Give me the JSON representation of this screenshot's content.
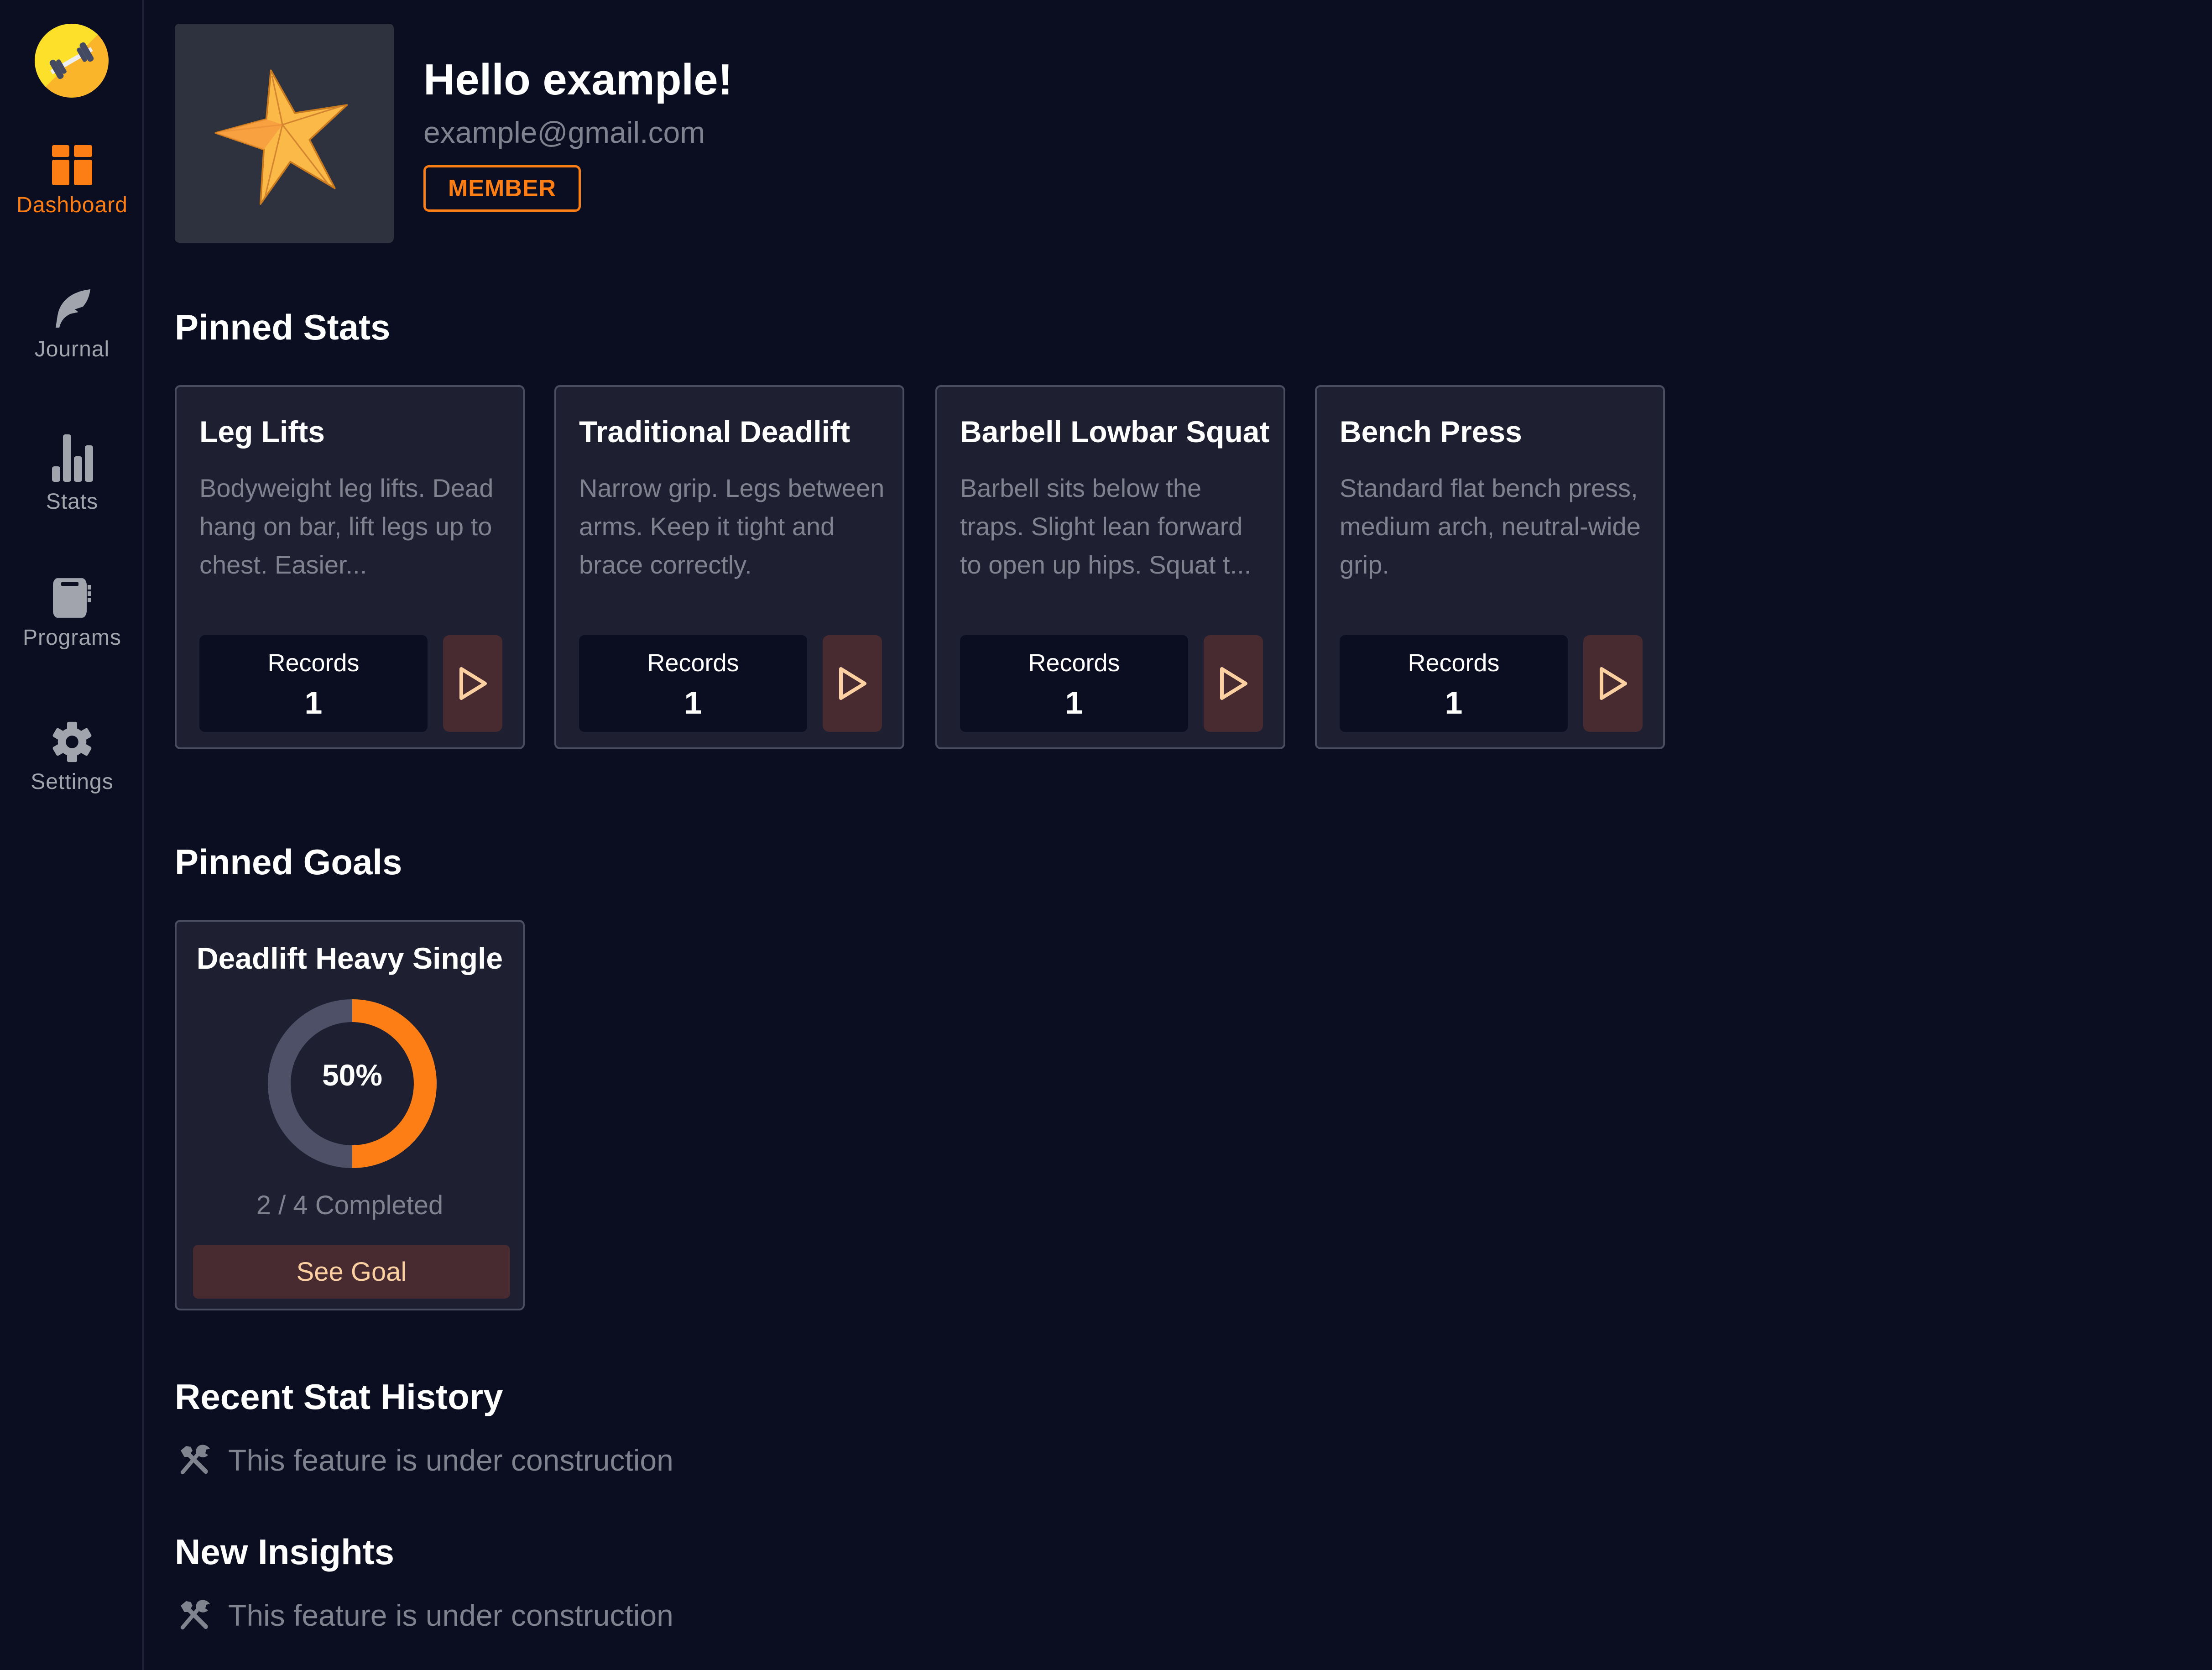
{
  "sidebar": {
    "logo": "dumbbell-logo",
    "items": [
      {
        "label": "Dashboard",
        "icon": "dashboard-icon",
        "active": true
      },
      {
        "label": "Journal",
        "icon": "feather-icon",
        "active": false
      },
      {
        "label": "Stats",
        "icon": "bar-chart-icon",
        "active": false
      },
      {
        "label": "Programs",
        "icon": "notebook-icon",
        "active": false
      },
      {
        "label": "Settings",
        "icon": "gear-icon",
        "active": false
      }
    ]
  },
  "profile": {
    "avatar": "starfish-avatar",
    "greeting": "Hello example!",
    "email": "example@gmail.com",
    "role": "MEMBER"
  },
  "pinned_stats": {
    "title": "Pinned Stats",
    "cards": [
      {
        "title": "Leg Lifts",
        "description": "Bodyweight leg lifts. Dead hang on bar, lift legs up to chest. Easier...",
        "records_label": "Records",
        "records_value": "1"
      },
      {
        "title": "Traditional Deadlift",
        "description": "Narrow grip. Legs between arms. Keep it tight and brace correctly.",
        "records_label": "Records",
        "records_value": "1"
      },
      {
        "title": "Barbell Lowbar Squat",
        "description": "Barbell sits below the traps. Slight lean forward to open up hips. Squat t...",
        "records_label": "Records",
        "records_value": "1"
      },
      {
        "title": "Bench Press",
        "description": "Standard flat bench press, medium arch, neutral-wide grip.",
        "records_label": "Records",
        "records_value": "1"
      }
    ]
  },
  "pinned_goals": {
    "title": "Pinned Goals",
    "goals": [
      {
        "title": "Deadlift Heavy Single",
        "percent_label": "50%",
        "progress": 0.5,
        "completed_text": "2 / 4 Completed",
        "button_label": "See Goal"
      }
    ]
  },
  "recent_stat_history": {
    "title": "Recent Stat History",
    "message": "This feature is under construction"
  },
  "new_insights": {
    "title": "New Insights",
    "message": "This feature is under construction"
  },
  "colors": {
    "accent": "#fd7e15",
    "background": "#0b0d20",
    "card": "#1e1f31",
    "card_border": "#4a4c60",
    "muted_text": "#80828f",
    "button_bg": "#482b30",
    "button_text": "#fcd0a1",
    "donut_track": "#4d5066"
  }
}
